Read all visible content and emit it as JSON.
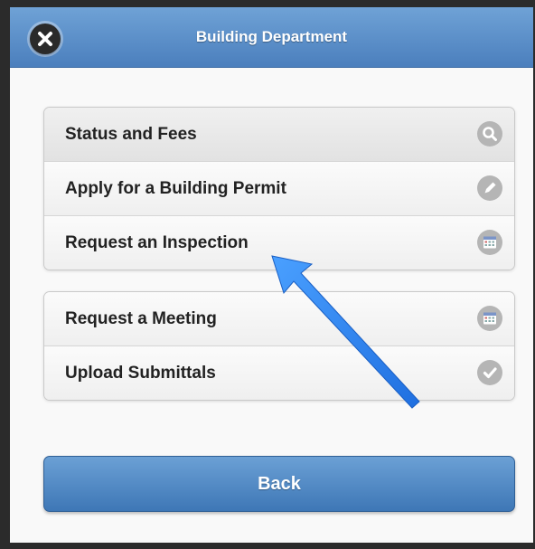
{
  "header": {
    "title": "Building Department"
  },
  "menu_group_1": [
    {
      "label": "Status and Fees",
      "icon": "search-icon"
    },
    {
      "label": "Apply for a Building Permit",
      "icon": "pencil-icon"
    },
    {
      "label": "Request an Inspection",
      "icon": "calendar-icon"
    }
  ],
  "menu_group_2": [
    {
      "label": "Request a Meeting",
      "icon": "calendar-icon"
    },
    {
      "label": "Upload Submittals",
      "icon": "checkmark-icon"
    }
  ],
  "footer": {
    "back_label": "Back"
  },
  "colors": {
    "header_blue": "#5b8fcb",
    "button_blue": "#4f87c4",
    "annotation_arrow": "#2f86f0",
    "icon_gray": "#b5b5b5"
  }
}
